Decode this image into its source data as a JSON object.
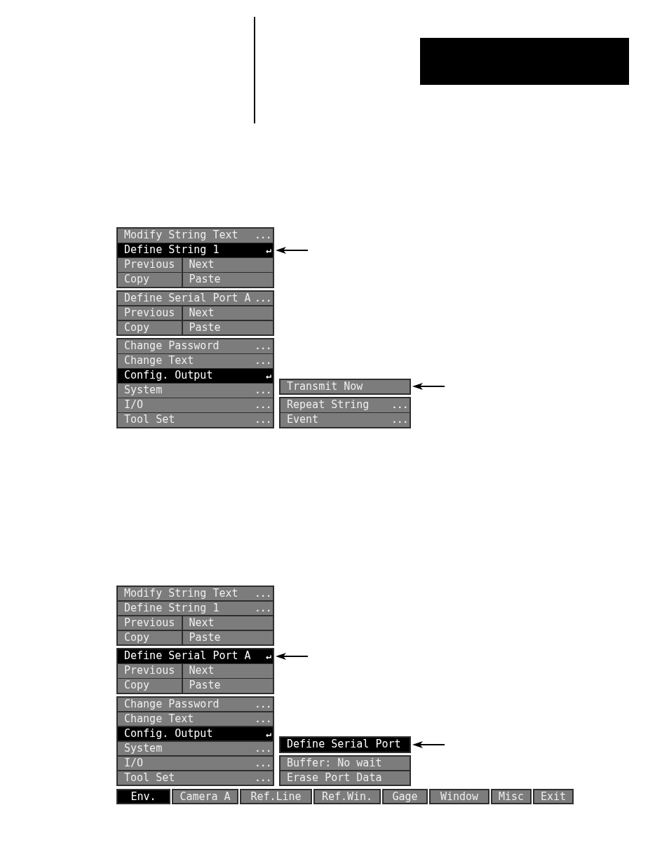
{
  "screens": [
    {
      "menu": {
        "groups": [
          {
            "rows": [
              {
                "kind": "item",
                "label": "Modify String Text",
                "suffix": "...",
                "selected": false,
                "arrow": false
              },
              {
                "kind": "item",
                "label": "Define String 1",
                "suffix": "↵",
                "selected": true,
                "arrow": true
              },
              {
                "kind": "pair",
                "cells": [
                  {
                    "label": "Previous",
                    "selected": false
                  },
                  {
                    "label": "Next",
                    "selected": false
                  }
                ]
              },
              {
                "kind": "pair",
                "cells": [
                  {
                    "label": "Copy",
                    "selected": false
                  },
                  {
                    "label": "Paste",
                    "selected": false
                  }
                ]
              }
            ]
          },
          {
            "rows": [
              {
                "kind": "item",
                "label": "Define Serial Port A",
                "suffix": "...",
                "selected": false,
                "arrow": false
              },
              {
                "kind": "pair",
                "cells": [
                  {
                    "label": "Previous",
                    "selected": false
                  },
                  {
                    "label": "Next",
                    "selected": false
                  }
                ]
              },
              {
                "kind": "pair",
                "cells": [
                  {
                    "label": "Copy",
                    "selected": false
                  },
                  {
                    "label": "Paste",
                    "selected": false
                  }
                ]
              }
            ]
          },
          {
            "rows": [
              {
                "kind": "item",
                "label": "Change Password",
                "suffix": "...",
                "selected": false,
                "arrow": false
              },
              {
                "kind": "item",
                "label": "Change Text",
                "suffix": "...",
                "selected": false,
                "arrow": false
              },
              {
                "kind": "item",
                "label": "Config. Output",
                "suffix": "↵",
                "selected": true,
                "arrow": false
              },
              {
                "kind": "item",
                "label": "System",
                "suffix": "...",
                "selected": false,
                "arrow": false
              },
              {
                "kind": "item",
                "label": "I/O",
                "suffix": "...",
                "selected": false,
                "arrow": false
              },
              {
                "kind": "item",
                "label": "Tool Set",
                "suffix": "...",
                "selected": false,
                "arrow": false
              }
            ]
          }
        ]
      },
      "submenu": {
        "groups": [
          {
            "rows": [
              {
                "kind": "item",
                "label": "Transmit Now",
                "selected": false,
                "arrow": true
              }
            ]
          },
          {
            "rows": [
              {
                "kind": "item",
                "label": "Repeat String",
                "suffix": "...",
                "selected": false,
                "arrow": false
              },
              {
                "kind": "item",
                "label": "Event",
                "suffix": "...",
                "selected": false,
                "arrow": false
              }
            ]
          }
        ]
      }
    },
    {
      "menu": {
        "groups": [
          {
            "rows": [
              {
                "kind": "item",
                "label": "Modify String Text",
                "suffix": "...",
                "selected": false,
                "arrow": false
              },
              {
                "kind": "item",
                "label": "Define String 1",
                "suffix": "...",
                "selected": false,
                "arrow": false
              },
              {
                "kind": "pair",
                "cells": [
                  {
                    "label": "Previous",
                    "selected": false
                  },
                  {
                    "label": "Next",
                    "selected": false
                  }
                ]
              },
              {
                "kind": "pair",
                "cells": [
                  {
                    "label": "Copy",
                    "selected": false
                  },
                  {
                    "label": "Paste",
                    "selected": false
                  }
                ]
              }
            ]
          },
          {
            "rows": [
              {
                "kind": "item",
                "label": "Define Serial Port A",
                "suffix": "↵",
                "selected": true,
                "arrow": true
              },
              {
                "kind": "pair",
                "cells": [
                  {
                    "label": "Previous",
                    "selected": false
                  },
                  {
                    "label": "Next",
                    "selected": false
                  }
                ]
              },
              {
                "kind": "pair",
                "cells": [
                  {
                    "label": "Copy",
                    "selected": false
                  },
                  {
                    "label": "Paste",
                    "selected": false
                  }
                ]
              }
            ]
          },
          {
            "rows": [
              {
                "kind": "item",
                "label": "Change Password",
                "suffix": "...",
                "selected": false,
                "arrow": false
              },
              {
                "kind": "item",
                "label": "Change Text",
                "suffix": "...",
                "selected": false,
                "arrow": false
              },
              {
                "kind": "item",
                "label": "Config. Output",
                "suffix": "↵",
                "selected": true,
                "arrow": false
              },
              {
                "kind": "item",
                "label": "System",
                "suffix": "...",
                "selected": false,
                "arrow": false
              },
              {
                "kind": "item",
                "label": "I/O",
                "suffix": "...",
                "selected": false,
                "arrow": false
              },
              {
                "kind": "item",
                "label": "Tool Set",
                "suffix": "...",
                "selected": false,
                "arrow": false
              }
            ]
          }
        ]
      },
      "submenu": {
        "groups": [
          {
            "rows": [
              {
                "kind": "item",
                "label": "Define Serial Port",
                "selected": true,
                "arrow": true
              }
            ]
          },
          {
            "rows": [
              {
                "kind": "item",
                "label": "Buffer: No wait",
                "selected": false,
                "arrow": false
              },
              {
                "kind": "item",
                "label": "Erase Port Data",
                "selected": false,
                "arrow": false
              }
            ]
          }
        ]
      },
      "tab_bar": [
        {
          "label": "Env.",
          "selected": true
        },
        {
          "label": "Camera A",
          "selected": false
        },
        {
          "label": "Ref.Line",
          "selected": false
        },
        {
          "label": "Ref.Win.",
          "selected": false
        },
        {
          "label": "Gage",
          "selected": false
        },
        {
          "label": "Window",
          "selected": false
        },
        {
          "label": "Misc",
          "selected": false
        },
        {
          "label": "Exit",
          "selected": false
        }
      ]
    }
  ]
}
